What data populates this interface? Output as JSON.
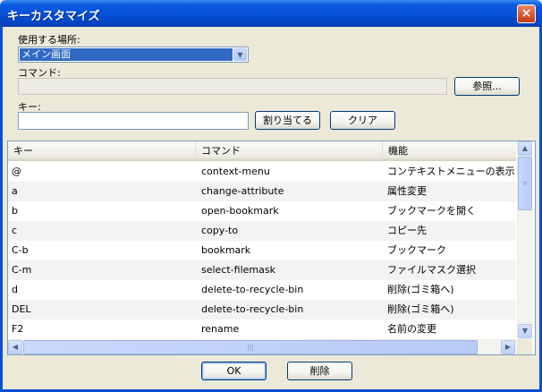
{
  "window": {
    "title": "キーカスタマイズ",
    "close_glyph": "×"
  },
  "location": {
    "label": "使用する場所:",
    "selected": "メイン画面"
  },
  "command": {
    "label": "コマンド:",
    "value": "",
    "browse_label": "参照..."
  },
  "key": {
    "label": "キー:",
    "value": "",
    "assign_label": "割り当てる",
    "clear_label": "クリア"
  },
  "table": {
    "columns": [
      "キー",
      "コマンド",
      "機能"
    ],
    "rows": [
      {
        "key": "@",
        "command": "context-menu",
        "function": "コンテキストメニューの表示"
      },
      {
        "key": "a",
        "command": "change-attribute",
        "function": "属性変更"
      },
      {
        "key": "b",
        "command": "open-bookmark",
        "function": "ブックマークを開く"
      },
      {
        "key": "c",
        "command": "copy-to",
        "function": "コピー先"
      },
      {
        "key": "C-b",
        "command": "bookmark",
        "function": "ブックマーク"
      },
      {
        "key": "C-m",
        "command": "select-filemask",
        "function": "ファイルマスク選択"
      },
      {
        "key": "d",
        "command": "delete-to-recycle-bin",
        "function": "削除(ゴミ箱へ)"
      },
      {
        "key": "DEL",
        "command": "delete-to-recycle-bin",
        "function": "削除(ゴミ箱へ)"
      },
      {
        "key": "F2",
        "command": "rename",
        "function": "名前の変更"
      }
    ]
  },
  "footer": {
    "ok_label": "OK",
    "delete_label": "削除"
  },
  "icons": {
    "dropdown": "chevron-down-icon",
    "scroll_up": "arrow-up-icon",
    "scroll_down": "arrow-down-icon",
    "scroll_left": "arrow-left-icon",
    "scroll_right": "arrow-right-icon"
  }
}
